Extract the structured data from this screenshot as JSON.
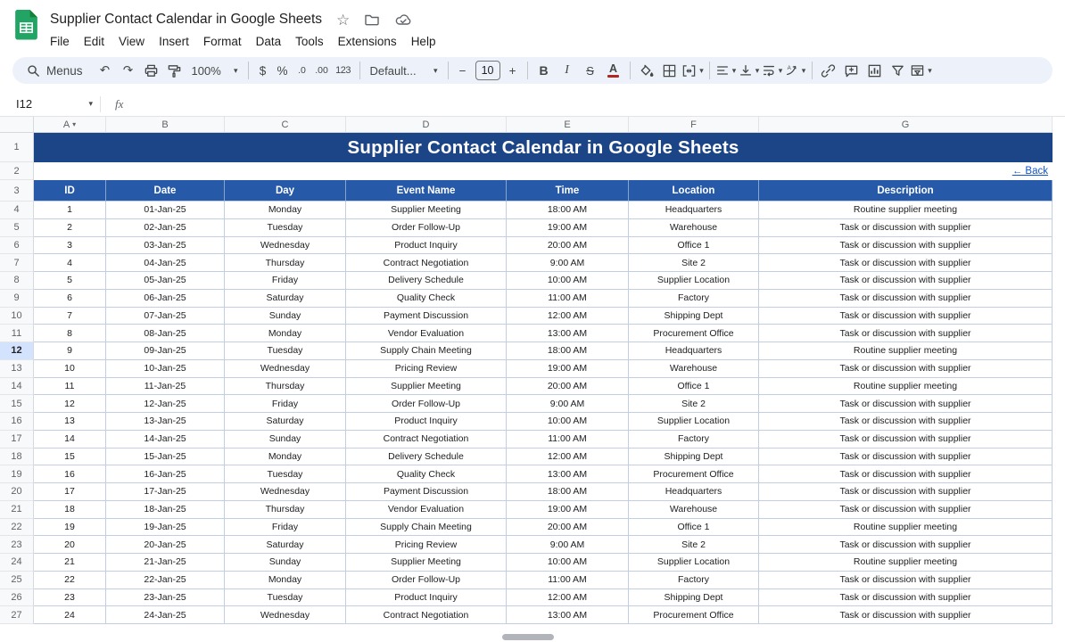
{
  "app": {
    "doc_title": "Supplier Contact Calendar in Google Sheets",
    "menus": [
      "File",
      "Edit",
      "View",
      "Insert",
      "Format",
      "Data",
      "Tools",
      "Extensions",
      "Help"
    ]
  },
  "toolbar": {
    "menus_label": "Menus",
    "zoom_value": "100%",
    "currency_label": "$",
    "percent_label": "%",
    "decrease_decimal_label": ".0",
    "increase_decimal_label": ".00",
    "number_format_label": "123",
    "font_family_value": "Default...",
    "decrease_font_label": "−",
    "font_size_value": "10",
    "increase_font_label": "+",
    "bold_label": "B",
    "italic_label": "I",
    "strikethrough_label": "S",
    "text_color_label": "A"
  },
  "formula_bar": {
    "name_box_value": "I12",
    "fx_label": "fx"
  },
  "grid": {
    "column_letters": [
      "A",
      "B",
      "C",
      "D",
      "E",
      "F",
      "G"
    ],
    "dropdown_column": "A",
    "row_count": 27,
    "active_row": 12
  },
  "sheet": {
    "title": "Supplier Contact Calendar in Google Sheets",
    "back_link": "← Back",
    "column_headers": [
      "ID",
      "Date",
      "Day",
      "Event Name",
      "Time",
      "Location",
      "Description"
    ],
    "rows": [
      [
        "1",
        "01-Jan-25",
        "Monday",
        "Supplier Meeting",
        "18:00 AM",
        "Headquarters",
        "Routine supplier meeting"
      ],
      [
        "2",
        "02-Jan-25",
        "Tuesday",
        "Order Follow-Up",
        "19:00 AM",
        "Warehouse",
        "Task or discussion with supplier"
      ],
      [
        "3",
        "03-Jan-25",
        "Wednesday",
        "Product Inquiry",
        "20:00 AM",
        "Office 1",
        "Task or discussion with supplier"
      ],
      [
        "4",
        "04-Jan-25",
        "Thursday",
        "Contract Negotiation",
        "9:00 AM",
        "Site 2",
        "Task or discussion with supplier"
      ],
      [
        "5",
        "05-Jan-25",
        "Friday",
        "Delivery Schedule",
        "10:00 AM",
        "Supplier Location",
        "Task or discussion with supplier"
      ],
      [
        "6",
        "06-Jan-25",
        "Saturday",
        "Quality Check",
        "11:00 AM",
        "Factory",
        "Task or discussion with supplier"
      ],
      [
        "7",
        "07-Jan-25",
        "Sunday",
        "Payment Discussion",
        "12:00 AM",
        "Shipping Dept",
        "Task or discussion with supplier"
      ],
      [
        "8",
        "08-Jan-25",
        "Monday",
        "Vendor Evaluation",
        "13:00 AM",
        "Procurement Office",
        "Task or discussion with supplier"
      ],
      [
        "9",
        "09-Jan-25",
        "Tuesday",
        "Supply Chain Meeting",
        "18:00 AM",
        "Headquarters",
        "Routine supplier meeting"
      ],
      [
        "10",
        "10-Jan-25",
        "Wednesday",
        "Pricing Review",
        "19:00 AM",
        "Warehouse",
        "Task or discussion with supplier"
      ],
      [
        "11",
        "11-Jan-25",
        "Thursday",
        "Supplier Meeting",
        "20:00 AM",
        "Office 1",
        "Routine supplier meeting"
      ],
      [
        "12",
        "12-Jan-25",
        "Friday",
        "Order Follow-Up",
        "9:00 AM",
        "Site 2",
        "Task or discussion with supplier"
      ],
      [
        "13",
        "13-Jan-25",
        "Saturday",
        "Product Inquiry",
        "10:00 AM",
        "Supplier Location",
        "Task or discussion with supplier"
      ],
      [
        "14",
        "14-Jan-25",
        "Sunday",
        "Contract Negotiation",
        "11:00 AM",
        "Factory",
        "Task or discussion with supplier"
      ],
      [
        "15",
        "15-Jan-25",
        "Monday",
        "Delivery Schedule",
        "12:00 AM",
        "Shipping Dept",
        "Task or discussion with supplier"
      ],
      [
        "16",
        "16-Jan-25",
        "Tuesday",
        "Quality Check",
        "13:00 AM",
        "Procurement Office",
        "Task or discussion with supplier"
      ],
      [
        "17",
        "17-Jan-25",
        "Wednesday",
        "Payment Discussion",
        "18:00 AM",
        "Headquarters",
        "Task or discussion with supplier"
      ],
      [
        "18",
        "18-Jan-25",
        "Thursday",
        "Vendor Evaluation",
        "19:00 AM",
        "Warehouse",
        "Task or discussion with supplier"
      ],
      [
        "19",
        "19-Jan-25",
        "Friday",
        "Supply Chain Meeting",
        "20:00 AM",
        "Office 1",
        "Routine supplier meeting"
      ],
      [
        "20",
        "20-Jan-25",
        "Saturday",
        "Pricing Review",
        "9:00 AM",
        "Site 2",
        "Task or discussion with supplier"
      ],
      [
        "21",
        "21-Jan-25",
        "Sunday",
        "Supplier Meeting",
        "10:00 AM",
        "Supplier Location",
        "Routine supplier meeting"
      ],
      [
        "22",
        "22-Jan-25",
        "Monday",
        "Order Follow-Up",
        "11:00 AM",
        "Factory",
        "Task or discussion with supplier"
      ],
      [
        "23",
        "23-Jan-25",
        "Tuesday",
        "Product Inquiry",
        "12:00 AM",
        "Shipping Dept",
        "Task or discussion with supplier"
      ],
      [
        "24",
        "24-Jan-25",
        "Wednesday",
        "Contract Negotiation",
        "13:00 AM",
        "Procurement Office",
        "Task or discussion with supplier"
      ]
    ]
  },
  "colors": {
    "banner_bg": "#1c4587",
    "header_bg": "#2659a8",
    "grid_border": "#c2cfe3",
    "active_row_bg": "#d3e3fd",
    "link_blue": "#1155cc",
    "logo_green": "#21a464"
  }
}
